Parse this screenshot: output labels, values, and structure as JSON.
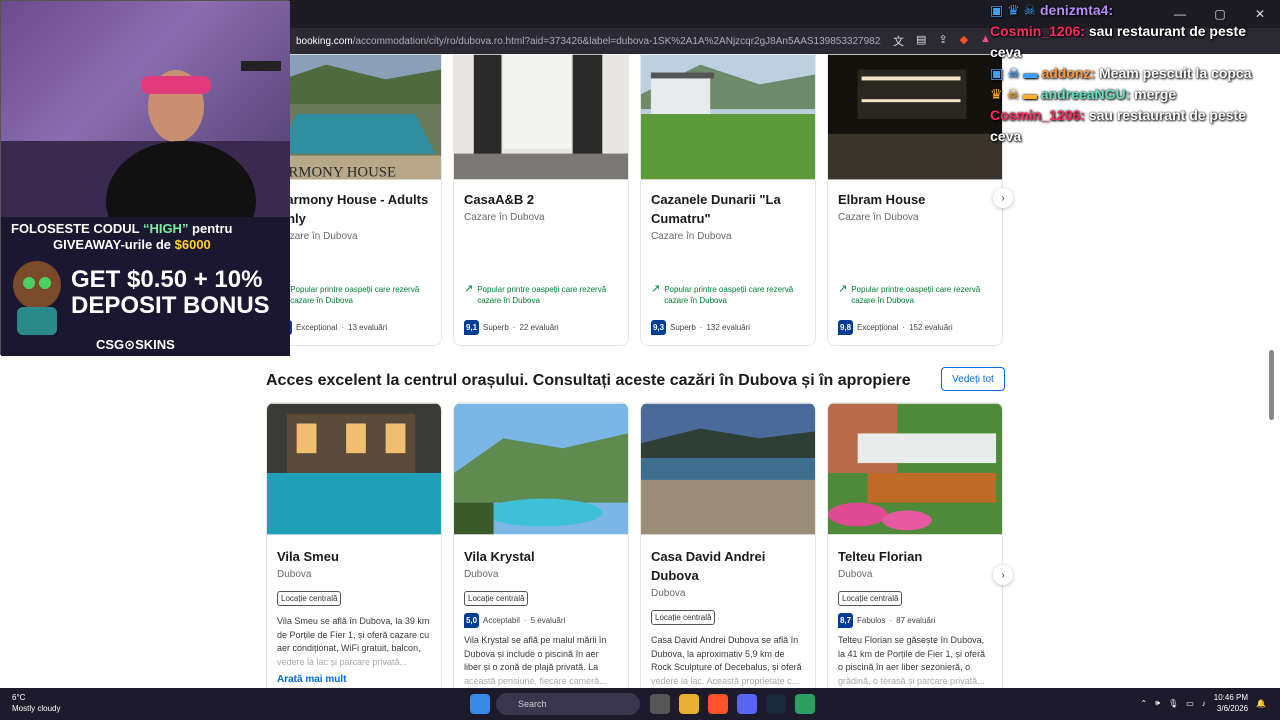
{
  "browser": {
    "url_domain": "booking.com",
    "url_rest": "/accommodation/city/ro/dubova.ro.html?aid=373426&label=dubova-1SK%2A1A%2ANjzcqr2gJ8An5AAS1398533279822%3A...",
    "window_controls": [
      "—",
      "▢",
      "✕"
    ]
  },
  "row1": [
    {
      "name": "Harmony House - Adults Only",
      "location": "Cazare în Dubova",
      "popular": "Popular printre oaspeții care rezervă cazare în Dubova",
      "score": "",
      "rating_word": "Excepțional",
      "reviews": "13 evaluări",
      "photo_text": "HARMONY HOUSE"
    },
    {
      "name": "CasaA&B 2",
      "location": "Cazare în Dubova",
      "popular": "Popular printre oaspeții care rezervă cazare în Dubova",
      "score": "9,1",
      "rating_word": "Superb",
      "reviews": "22 evaluări"
    },
    {
      "name": "Cazanele Dunarii \"La Cumatru\"",
      "location": "Cazare în Dubova",
      "popular": "Popular printre oaspeții care rezervă cazare în Dubova",
      "score": "9,3",
      "rating_word": "Superb",
      "reviews": "132 evaluări"
    },
    {
      "name": "Elbram House",
      "location": "Cazare în Dubova",
      "popular": "Popular printre oaspeții care rezervă cazare în Dubova",
      "score": "9,8",
      "rating_word": "Excepțional",
      "reviews": "152 evaluări"
    }
  ],
  "section2": {
    "heading": "Acces excelent la centrul orașului. Consultați aceste cazări în Dubova și în apropiere",
    "see_all": "Vedeți tot"
  },
  "row2": [
    {
      "name": "Vila Smeu",
      "location": "Dubova",
      "tag": "Locație centrală",
      "desc": "Vila Smeu se află în Dubova, la 39 km de Porțile de Fier 1, și oferă cazare cu aer condiționat, WiFi gratuit, balcon,",
      "desc_fade": "vedere la lac și parcare privată...",
      "more": "Arată mai mult"
    },
    {
      "name": "Vila Krystal",
      "location": "Dubova",
      "tag": "Locație centrală",
      "score": "5,0",
      "rating_word": "Acceptabil",
      "reviews": "5 evaluări",
      "desc": "Vila Krystal se află pe malul mării în Dubova și include o piscină în aer liber și o zonă de plajă privată. La",
      "desc_fade": "această pensiune, fiecare cameră..."
    },
    {
      "name": "Casa David Andrei Dubova",
      "location": "Dubova",
      "tag": "Locație centrală",
      "desc": "Casa David Andrei Dubova se află în Dubova, la aproximativ 5,9 km de Rock Sculpture of Decebalus, și oferă",
      "desc_fade": "vedere la lac. Această proprietate c..."
    },
    {
      "name": "Telteu Florian",
      "location": "Dubova",
      "tag": "Locație centrală",
      "score": "8,7",
      "rating_word": "Fabulos",
      "reviews": "87 evaluări",
      "desc": "Telteu Florian se găsește în Dubova, la 41 km de Porțile de Fier 1, și oferă o piscină în aer liber sezonieră, o",
      "desc_fade": "grădină, o terasă și parcare privată..."
    }
  ],
  "stream": {
    "promo_line1_a": "FOLOSESTE CODUL ",
    "promo_code": "“HIGH”",
    "promo_line1_b": " pentru",
    "promo_line2_a": "GIVEAWAY-urile de ",
    "promo_amount": "$6000",
    "promo_big1": "GET $0.50 + 10%",
    "promo_big2": "DEPOSIT BONUS",
    "promo_logo": "CSG⊙SKINS"
  },
  "chat": [
    {
      "user": "denizmta4:",
      "text": "",
      "color": "#b98bff"
    },
    {
      "user": "Cosmin_1206:",
      "text": "sau restaurant de peste ceva",
      "color": "#ff2b5e"
    },
    {
      "user": "addonz:",
      "text": "Meam pescuit la copca",
      "color": "#ff9a3c"
    },
    {
      "user": "andreeaNGU:",
      "text": "merge",
      "color": "#67e0c0"
    },
    {
      "user": "Cosmin_1206:",
      "text": "sau restaurant de peste ceva",
      "color": "#ff2b5e"
    }
  ],
  "taskbar": {
    "temp": "6°C",
    "weather": "Mostly cloudy",
    "search": "Search",
    "time": "10:46 PM",
    "date": "3/6/2026"
  }
}
